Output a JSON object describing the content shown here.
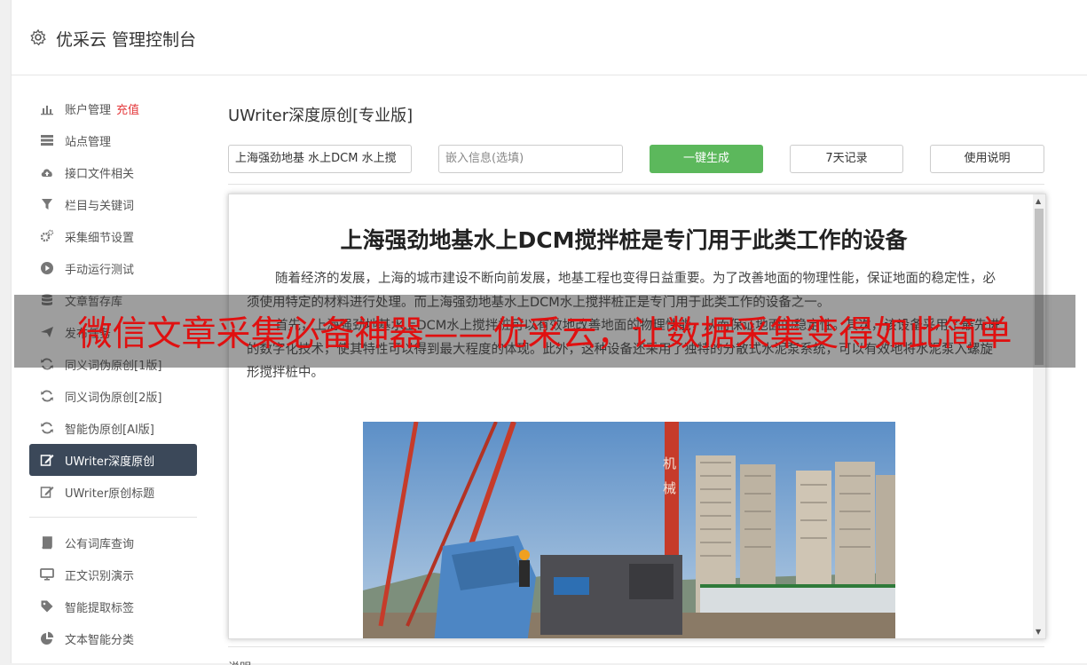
{
  "header": {
    "title": "优采云 管理控制台",
    "icon": "gear-icon"
  },
  "sidebar": {
    "group1": [
      {
        "label": "账户管理",
        "extra": "充值",
        "icon": "bar-chart-icon"
      },
      {
        "label": "站点管理",
        "icon": "server-icon"
      },
      {
        "label": "接口文件相关",
        "icon": "cloud-upload-icon"
      },
      {
        "label": "栏目与关键词",
        "icon": "filter-icon"
      },
      {
        "label": "采集细节设置",
        "icon": "gears-icon"
      },
      {
        "label": "手动运行测试",
        "icon": "play-icon"
      },
      {
        "label": "文章暂存库",
        "icon": "database-icon"
      },
      {
        "label": "发布任务",
        "icon": "send-icon"
      }
    ],
    "group2": [
      {
        "label": "同义词伪原创[1版]",
        "icon": "refresh-icon"
      },
      {
        "label": "同义词伪原创[2版]",
        "icon": "refresh-icon"
      },
      {
        "label": "智能伪原创[AI版]",
        "icon": "refresh-icon"
      },
      {
        "label": "UWriter深度原创",
        "icon": "edit-icon",
        "active": true
      },
      {
        "label": "UWriter原创标题",
        "icon": "edit-icon"
      }
    ],
    "group3": [
      {
        "label": "公有词库查询",
        "icon": "book-icon"
      },
      {
        "label": "正文识别演示",
        "icon": "monitor-icon"
      },
      {
        "label": "智能提取标签",
        "icon": "tag-icon"
      },
      {
        "label": "文本智能分类",
        "icon": "pie-chart-icon"
      }
    ]
  },
  "main": {
    "title": "UWriter深度原创[专业版]",
    "keyword_input": "上海强劲地基 水上DCM 水上搅",
    "embed_placeholder": "嵌入信息(选填)",
    "generate_btn": "一键生成",
    "history_btn": "7天记录",
    "help_btn": "使用说明",
    "bottom_label": "说明"
  },
  "article": {
    "title": "上海强劲地基水上DCM搅拌桩是专门用于此类工作的设备",
    "paragraphs": [
      "随着经济的发展，上海的城市建设不断向前发展，地基工程也变得日益重要。为了改善地面的物理性能，保证地面的稳定性，必须使用特定的材料进行处理。而上海强劲地基水上DCM水上搅拌桩正是专门用于此类工作的设备之一。",
      "首先，上海强劲地基水上DCM水上搅拌桩可以有效地改善地面的物理性能，从而保证地面的稳定性。其次，该设备采用了最先进的数字化技术，使其特性可以得到最大程度的体现。此外，这种设备还采用了独特的分散式水泥泵系统，可以有效地将水泥泵入螺旋形搅拌桩中。"
    ],
    "photo_text": "机械"
  },
  "banner": {
    "text": "微信文章采集必备神器——优采云，让数据采集变得如此简单",
    "color": "#e01010"
  }
}
